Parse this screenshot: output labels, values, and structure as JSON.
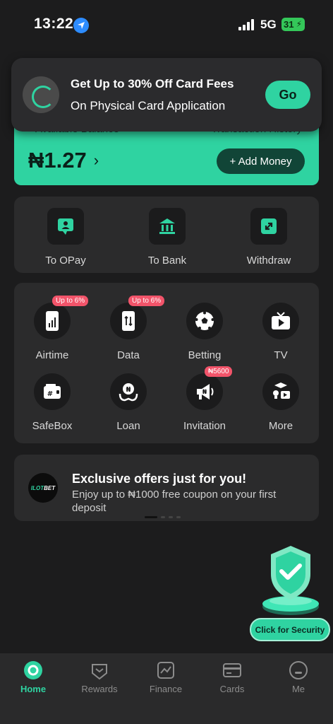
{
  "status": {
    "time": "13:22",
    "network": "5G",
    "battery": "31"
  },
  "promo": {
    "title": "Get Up to 30% Off Card Fees",
    "subtitle": "On Physical Card Application",
    "button": "Go"
  },
  "balance": {
    "label": "Available Balance",
    "history": "Transaction History",
    "amount": "₦1.27",
    "add_money": "+ Add Money"
  },
  "transfer": {
    "items": [
      {
        "label": "To OPay",
        "icon": "person-chat-icon"
      },
      {
        "label": "To Bank",
        "icon": "bank-icon"
      },
      {
        "label": "Withdraw",
        "icon": "withdraw-icon"
      }
    ]
  },
  "services": {
    "items": [
      {
        "label": "Airtime",
        "badge": "Up to 6%",
        "icon": "airtime-icon"
      },
      {
        "label": "Data",
        "badge": "Up to 6%",
        "icon": "data-icon"
      },
      {
        "label": "Betting",
        "badge": "",
        "icon": "football-icon"
      },
      {
        "label": "TV",
        "badge": "",
        "icon": "tv-icon"
      },
      {
        "label": "SafeBox",
        "badge": "",
        "icon": "safebox-icon"
      },
      {
        "label": "Loan",
        "badge": "",
        "icon": "loan-icon"
      },
      {
        "label": "Invitation",
        "badge": "₦5600",
        "icon": "megaphone-icon"
      },
      {
        "label": "More",
        "badge": "",
        "icon": "more-icon"
      }
    ]
  },
  "offer": {
    "logo": "ILOTBET",
    "title": "Exclusive offers just for you!",
    "text": "Enjoy up to ₦1000 free coupon on your first deposit"
  },
  "security": {
    "button": "Click for Security"
  },
  "nav": {
    "items": [
      {
        "label": "Home",
        "icon": "home-icon",
        "active": true
      },
      {
        "label": "Rewards",
        "icon": "rewards-icon",
        "active": false
      },
      {
        "label": "Finance",
        "icon": "finance-icon",
        "active": false
      },
      {
        "label": "Cards",
        "icon": "cards-icon",
        "active": false
      },
      {
        "label": "Me",
        "icon": "me-icon",
        "active": false
      }
    ]
  },
  "colors": {
    "accent": "#2fd3a1",
    "background": "#1c1c1d",
    "card": "#2b2b2c",
    "badge": "#f2546a"
  }
}
